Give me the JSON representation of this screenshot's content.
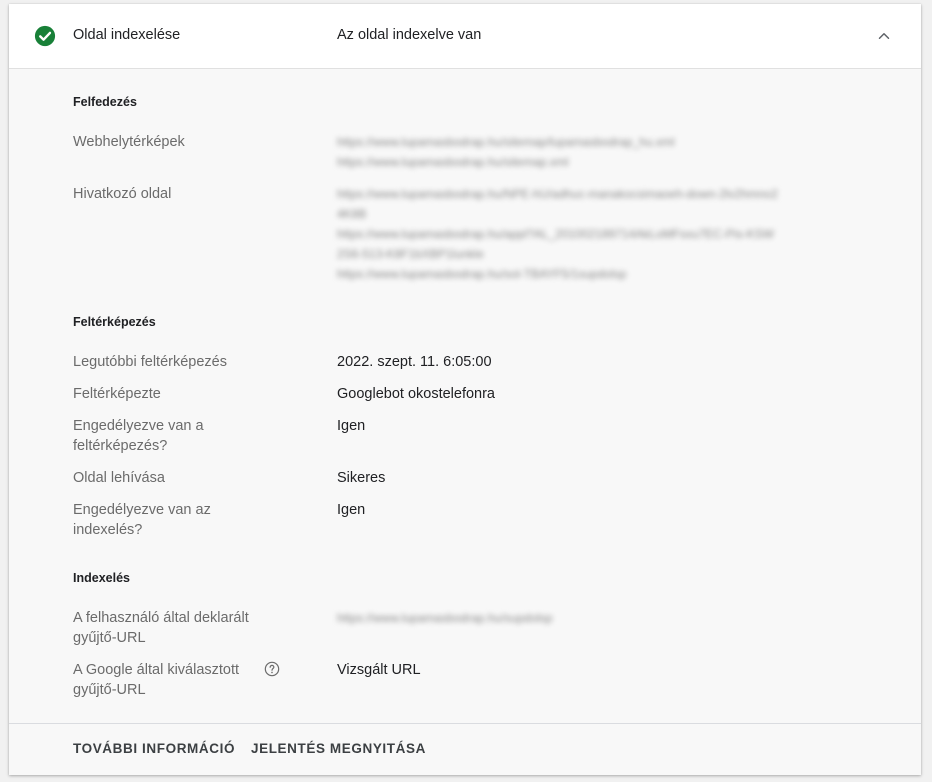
{
  "header": {
    "title": "Oldal indexelése",
    "status": "Az oldal indexelve van",
    "status_icon": "check-circle-icon",
    "status_color": "#188038",
    "collapse_icon": "chevron-up-icon"
  },
  "discovery": {
    "title": "Felfedezés",
    "sitemaps_label": "Webhelytérképek",
    "sitemaps": [
      "https://www.lupamasbodrap.hu/sitemap/lupamasbodrap_hu.xml",
      "https://www.lupamasbodrap.hu/sitemap.xml"
    ],
    "referring_label": "Hivatkozó oldal",
    "referring": [
      "https://www.lupamasbodrap.hu/NPE-hU/adhuc-manakocsimaoeh-down-2lv2hmno2",
      "4K8B",
      "https://www.lupamasbodrap.hu/appl?AL_201002189714AkLoMFsxu7EC-Pis-KSW",
      "2S6-513-K8F1bXBP1lunkle",
      "https://www.lupamasbodrap.hu/sol-TBAYF5/1supdolsp"
    ]
  },
  "crawl": {
    "title": "Feltérképezés",
    "rows": [
      {
        "label": "Legutóbbi feltérképezés",
        "value": "2022. szept. 11. 6:05:00"
      },
      {
        "label": "Feltérképezte",
        "value": "Googlebot okostelefonra"
      },
      {
        "label": "Engedélyezve van a feltérképezés?",
        "value": "Igen"
      },
      {
        "label": "Oldal lehívása",
        "value": "Sikeres"
      },
      {
        "label": "Engedélyezve van az indexelés?",
        "value": "Igen"
      }
    ]
  },
  "indexing": {
    "title": "Indexelés",
    "user_canonical_label": "A felhasználó által deklarált gyűjtő-URL",
    "user_canonical": "https://www.lupamasbodrap.hu/supdolsp",
    "google_canonical_label": "A Google által kiválasztott gyűjtő-URL",
    "google_canonical": "Vizsgált URL",
    "help_icon": "help-circle-icon"
  },
  "footer": {
    "more_info": "TOVÁBBI INFORMÁCIÓ",
    "open_report": "JELENTÉS MEGNYITÁSA"
  }
}
